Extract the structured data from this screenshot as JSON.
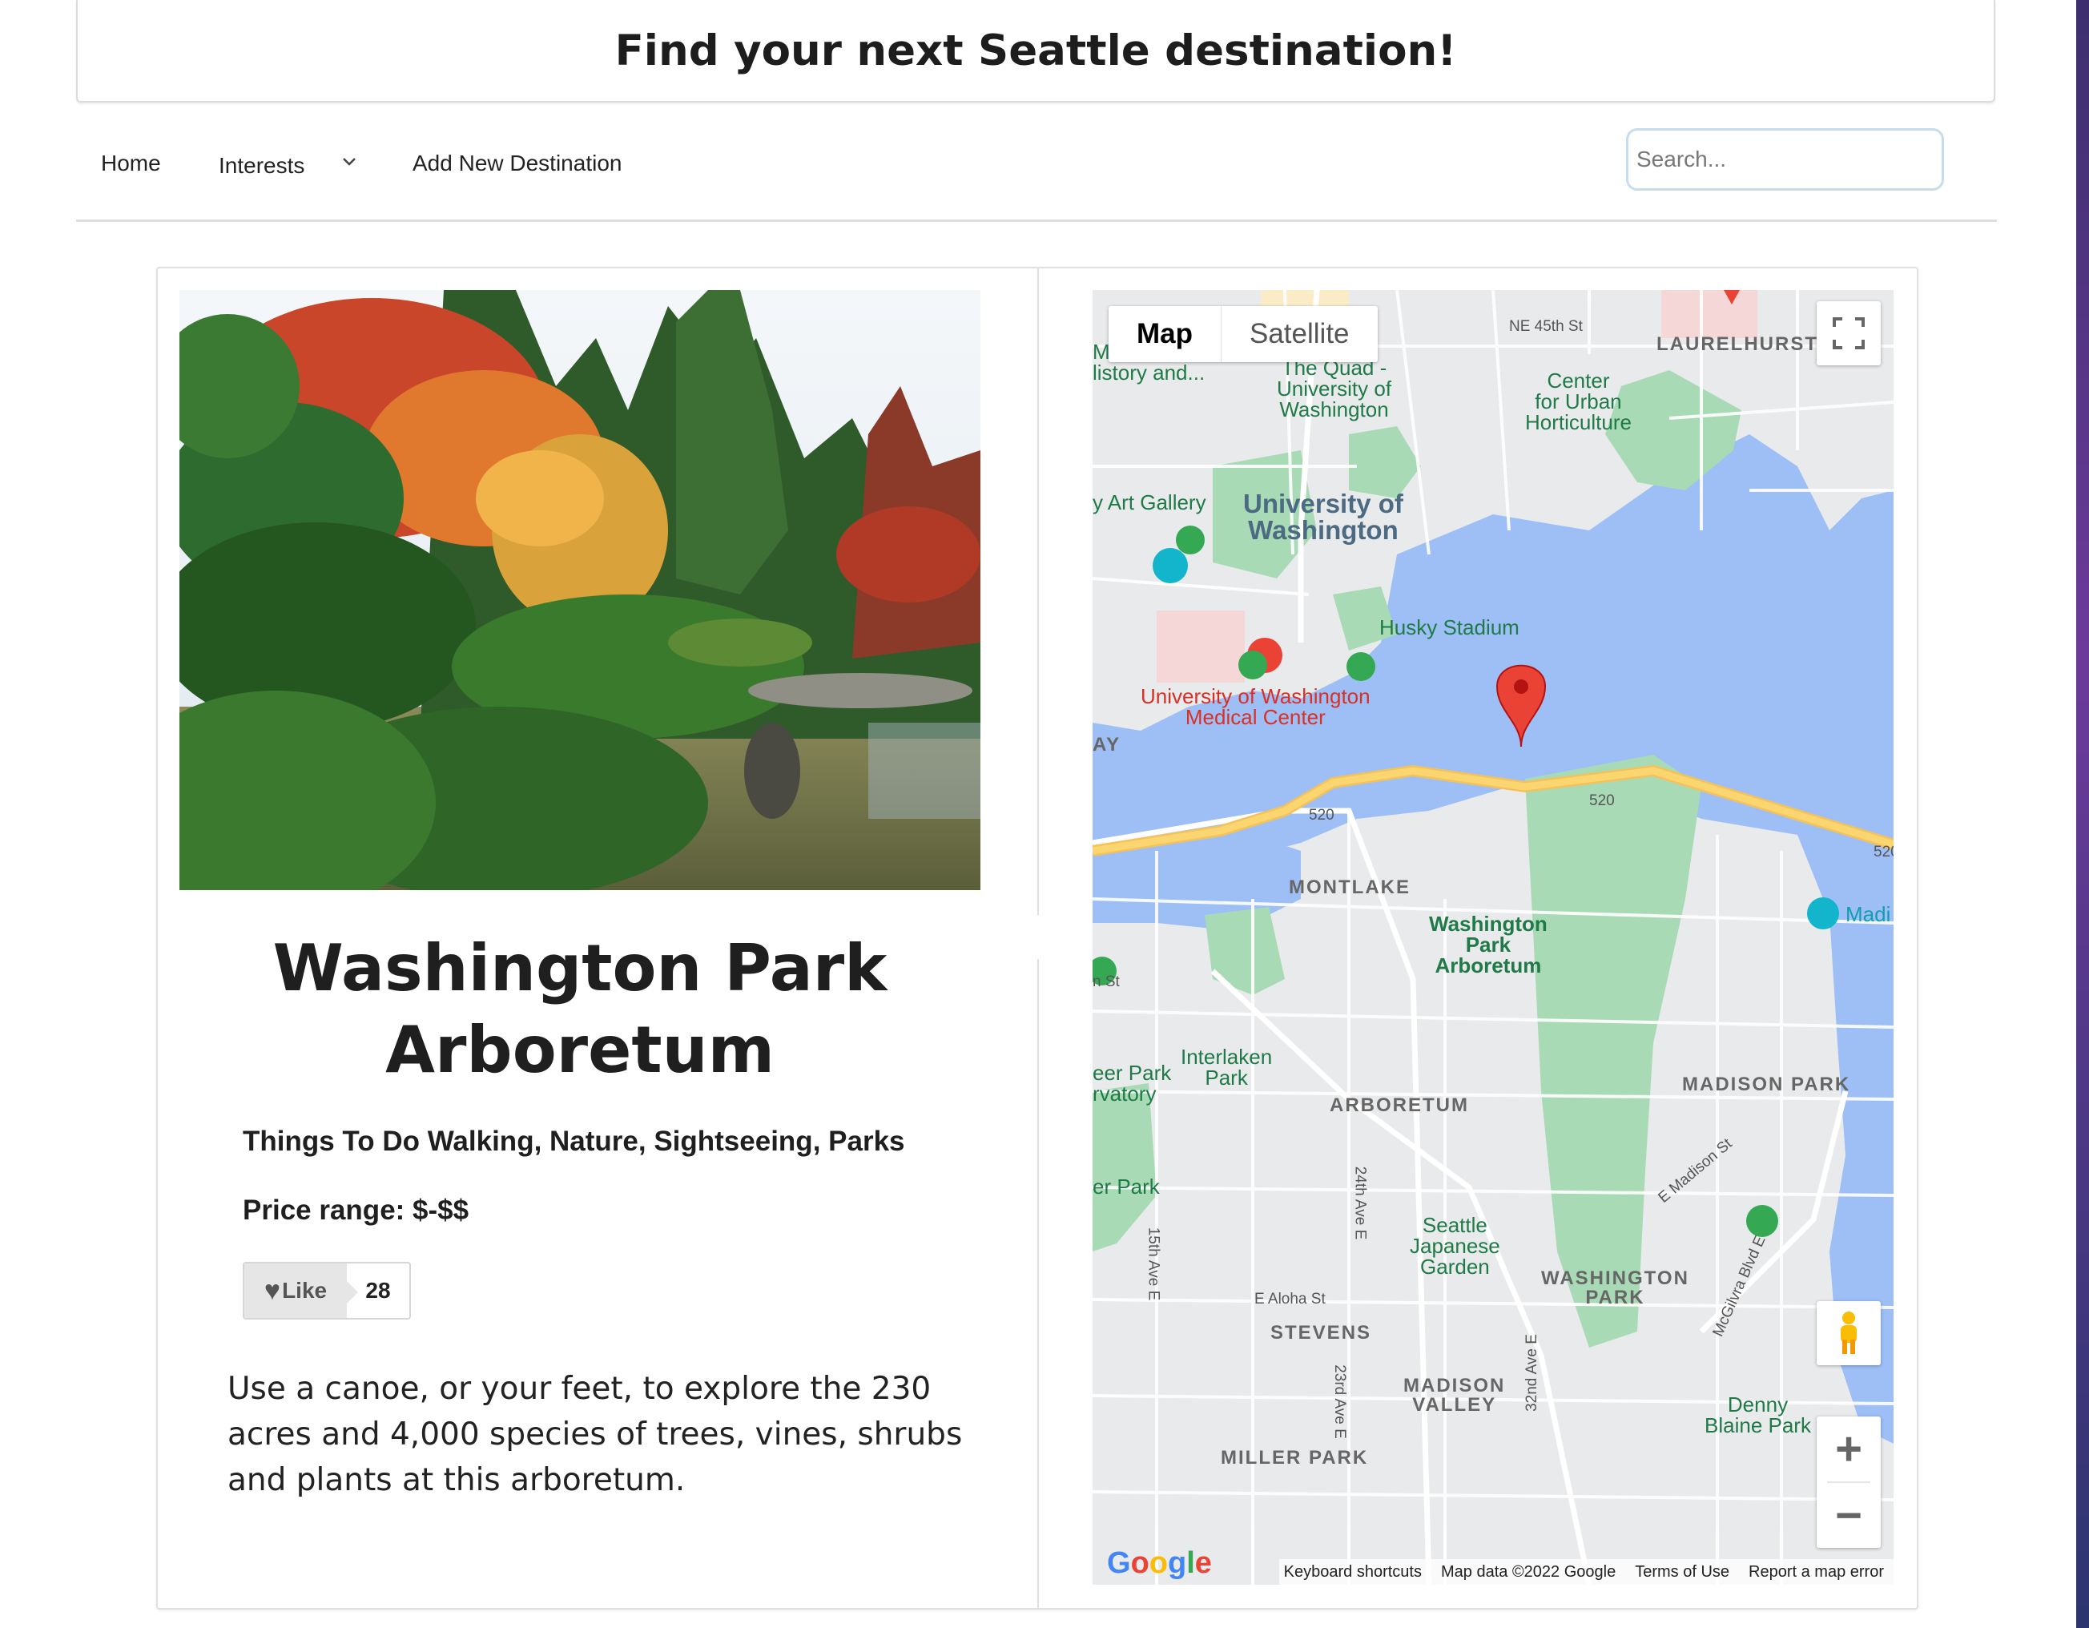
{
  "header": {
    "title": "Find your next Seattle destination!"
  },
  "nav": {
    "home_label": "Home",
    "interests_label": "Interests",
    "add_label": "Add New Destination",
    "search_placeholder": "Search..."
  },
  "destination": {
    "title": "Washington Park Arboretum",
    "things_to_do": "Things To Do Walking, Nature, Sightseeing, Parks",
    "price_range": "Price range: $-$$",
    "like_label": "Like",
    "like_count": "28",
    "description": "Use a canoe, or your feet, to explore the 230 acres and 4,000 species of trees, vines, shrubs and plants at this arboretum."
  },
  "map": {
    "tabs": [
      "Map",
      "Satellite"
    ],
    "active_tab": "Map",
    "logo_text": "Google",
    "attribution": [
      "Keyboard shortcuts",
      "Map data ©2022 Google",
      "Terms of Use",
      "Report a map error"
    ],
    "labels": {
      "ne45": "NE 45th St",
      "laurelhurst": "LAURELHURST",
      "museum": "Museum of\nlistory and...",
      "quad": "The Quad -\nUniversity of\nWashington",
      "center": "Center\nfor Urban\nHorticulture",
      "artgallery": "y Art Gallery",
      "uw": "University of\nWashington",
      "husky": "Husky Stadium",
      "uwmc": "University of Washington\nMedical Center",
      "ay": "AY",
      "r520a": "520",
      "r520b": "520",
      "r520c": "520",
      "montlake": "MONTLAKE",
      "wpa": "Washington\nPark\nArboretum",
      "nst": "n St",
      "madi": "Madi",
      "interlaken": "Interlaken\nPark",
      "eerpark": "eer Park\nrvatory",
      "arboretum": "ARBORETUM",
      "madisonpark": "MADISON PARK",
      "emadison": "E Madison St",
      "ave24": "24th Ave E",
      "erpark": "er Park",
      "ave15": "15th Ave E",
      "japanese": "Seattle\nJapanese\nGarden",
      "washpark": "WASHINGTON\nPARK",
      "mcgilvra": "McGilvra Blvd E",
      "aloha": "E Aloha St",
      "stevens": "STEVENS",
      "ave23": "23rd Ave E",
      "madvalley": "MADISON\nVALLEY",
      "ave32": "32nd Ave E",
      "denny": "Denny\nBlaine Park",
      "millerpark": "MILLER PARK"
    }
  },
  "colors": {
    "water": "#9dbff6",
    "park": "#a8dab5",
    "land": "#e9eaec",
    "highway": "#fbd570",
    "marker": "#ea4335"
  }
}
